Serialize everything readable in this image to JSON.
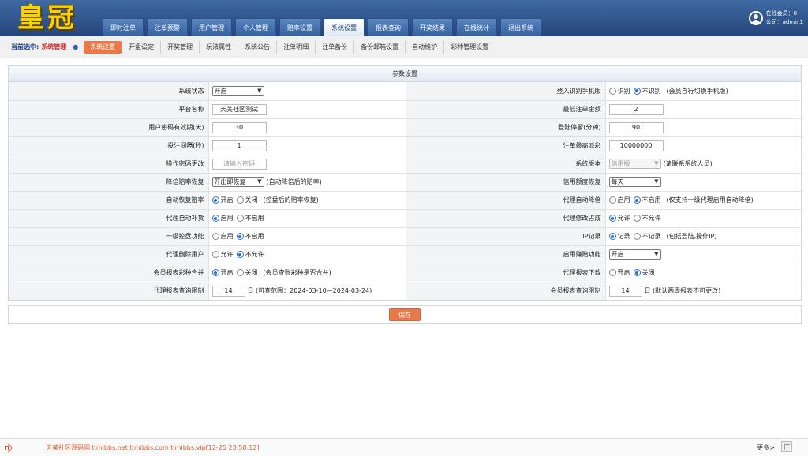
{
  "header": {
    "logo_text": "皇冠",
    "nav_tabs": [
      {
        "label": "即时注单"
      },
      {
        "label": "注单预警"
      },
      {
        "label": "用户管理"
      },
      {
        "label": "个人管理"
      },
      {
        "label": "赔率设置"
      },
      {
        "label": "系统设置",
        "active": true
      },
      {
        "label": "报表查询"
      },
      {
        "label": "开奖结果"
      },
      {
        "label": "在线统计"
      },
      {
        "label": "退出系统"
      }
    ],
    "online_members": "在线会员：0",
    "company": "公司：admin1"
  },
  "subnav": {
    "current_label": "当前选中:",
    "current_value": "系统管理",
    "items": [
      {
        "label": "系统设置",
        "active": true
      },
      {
        "label": "开盘设定"
      },
      {
        "label": "开奖管理"
      },
      {
        "label": "玩法属性"
      },
      {
        "label": "系统公告"
      },
      {
        "label": "注单明细"
      },
      {
        "label": "注单备份"
      },
      {
        "label": "备份邮箱设置"
      },
      {
        "label": "自动维护"
      },
      {
        "label": "彩种管理设置"
      }
    ]
  },
  "panel": {
    "title": "参数设置",
    "rows": [
      {
        "left": {
          "label": "系统状态",
          "select": "开启"
        },
        "right": {
          "label": "登入识别手机版",
          "radios": [
            {
              "label": "识别",
              "checked": false
            },
            {
              "label": "不识别",
              "checked": true
            }
          ],
          "note": "(会员自行切换手机版)"
        }
      },
      {
        "left": {
          "label": "平台名称",
          "input": "天美社区测试"
        },
        "right": {
          "label": "最低注单金额",
          "input": "2"
        }
      },
      {
        "left": {
          "label": "用户密码有效期(天)",
          "input": "30"
        },
        "right": {
          "label": "登陆停留(分钟)",
          "input": "90"
        }
      },
      {
        "left": {
          "label": "投注间隔(秒)",
          "input": "1"
        },
        "right": {
          "label": "注单最高派彩",
          "input": "10000000"
        }
      },
      {
        "left": {
          "label": "操作密码更改",
          "placeholder": "请输入密码"
        },
        "right": {
          "label": "系统版本",
          "select_disabled": "信用版",
          "note": "(请联系系统人员)"
        }
      },
      {
        "left": {
          "label": "降倍赔率恢复",
          "select": "开出即恢复",
          "note": "(自动降倍后的赔率)"
        },
        "right": {
          "label": "信用额度恢复",
          "select": "每天"
        }
      },
      {
        "left": {
          "label": "自动恢复赔率",
          "radios": [
            {
              "label": "开启",
              "checked": true
            },
            {
              "label": "关闭",
              "checked": false
            }
          ],
          "note": "(控盘后的赔率恢复)"
        },
        "right": {
          "label": "代理自动降倍",
          "radios": [
            {
              "label": "启用",
              "checked": false
            },
            {
              "label": "不启用",
              "checked": true
            }
          ],
          "note": "(仅支持一级代理启用自动降倍)"
        }
      },
      {
        "left": {
          "label": "代理自动补货",
          "radios": [
            {
              "label": "启用",
              "checked": true
            },
            {
              "label": "不启用",
              "checked": false
            }
          ]
        },
        "right": {
          "label": "代理修改占成",
          "radios": [
            {
              "label": "允许",
              "checked": true
            },
            {
              "label": "不允许",
              "checked": false
            }
          ]
        }
      },
      {
        "left": {
          "label": "一级控盘功能",
          "radios": [
            {
              "label": "启用",
              "checked": false
            },
            {
              "label": "不启用",
              "checked": true
            }
          ]
        },
        "right": {
          "label": "IP记录",
          "radios": [
            {
              "label": "记录",
              "checked": true
            },
            {
              "label": "不记录",
              "checked": false
            }
          ],
          "note": "(包括登陆,操作IP)"
        }
      },
      {
        "left": {
          "label": "代理删除用户",
          "radios": [
            {
              "label": "允许",
              "checked": false
            },
            {
              "label": "不允许",
              "checked": true
            }
          ]
        },
        "right": {
          "label": "启用赚赔功能",
          "select": "开启"
        }
      },
      {
        "left": {
          "label": "会员报表彩种合并",
          "radios": [
            {
              "label": "开启",
              "checked": true
            },
            {
              "label": "关闭",
              "checked": false
            }
          ],
          "note": "(会员查账彩种是否合并)"
        },
        "right": {
          "label": "代理报表下载",
          "radios": [
            {
              "label": "开启",
              "checked": false
            },
            {
              "label": "关闭",
              "checked": true
            }
          ]
        }
      },
      {
        "left": {
          "label": "代理报表查询限制",
          "input": "14",
          "note": "日 (可查范围：2024-03-10—2024-03-24)"
        },
        "right": {
          "label": "会员报表查询限制",
          "input": "14",
          "note": "日 (默认两周报表不可更改)"
        }
      }
    ]
  },
  "save_label": "保存",
  "footer": {
    "marquee": "天美社区源码网 timibbs.net timibbs.com timibbs.vip[12-25 23:58:12]",
    "more_label": "更多>"
  },
  "colors": {
    "header_top": "#3f6aa3",
    "header_bottom": "#24457a",
    "logo": "#f6d400",
    "accent": "#e9794a",
    "radio_checked": "#2c6fd6",
    "footer_text": "#e05a2b"
  },
  "icons": [
    "user-avatar-icon",
    "breadcrumb-arrow-icon",
    "speaker-icon",
    "corner-window-icon",
    "chevron-down-icon"
  ]
}
